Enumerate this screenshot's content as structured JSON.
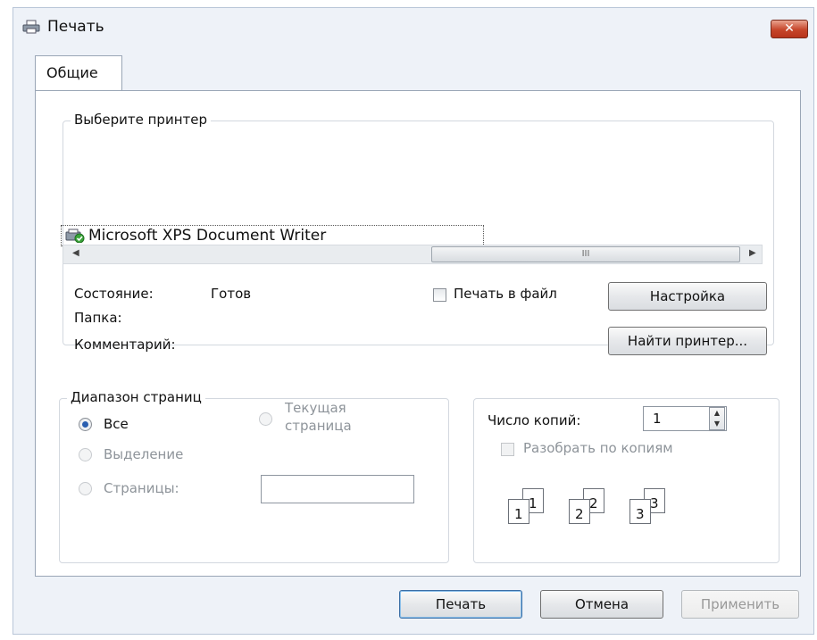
{
  "window": {
    "title": "Печать",
    "close_label": "✕"
  },
  "tabs": [
    {
      "label": "Общие"
    }
  ],
  "printer_group": {
    "legend": "Выберите принтер",
    "printers": [
      {
        "name": "Microsoft XPS Document Writer",
        "selected": true
      }
    ],
    "scroll_thumb_label": "III"
  },
  "status": {
    "state_label": "Состояние:",
    "state_value": "Готов",
    "folder_label": "Папка:",
    "comment_label": "Комментарий:"
  },
  "print_to_file": {
    "label": "Печать в файл",
    "checked": false
  },
  "buttons": {
    "settings": "Настройка",
    "find_printer": "Найти принтер...",
    "print": "Печать",
    "cancel": "Отмена",
    "apply": "Применить"
  },
  "page_range": {
    "legend": "Диапазон страниц",
    "options": [
      {
        "label": "Все",
        "checked": true,
        "enabled": true
      },
      {
        "label": "Выделение",
        "checked": false,
        "enabled": false
      },
      {
        "label": "Страницы:",
        "checked": false,
        "enabled": false
      },
      {
        "label_line1": "Текущая",
        "label_line2": "страница",
        "checked": false,
        "enabled": false
      }
    ],
    "pages_value": ""
  },
  "copies": {
    "label": "Число копий:",
    "value": "1",
    "collate_label": "Разобрать по копиям",
    "collate_checked": false,
    "collate_pages": [
      "1",
      "1",
      "2",
      "2",
      "3",
      "3"
    ]
  },
  "colors": {
    "accent": "#2a5fb0",
    "close": "#c6452a"
  }
}
